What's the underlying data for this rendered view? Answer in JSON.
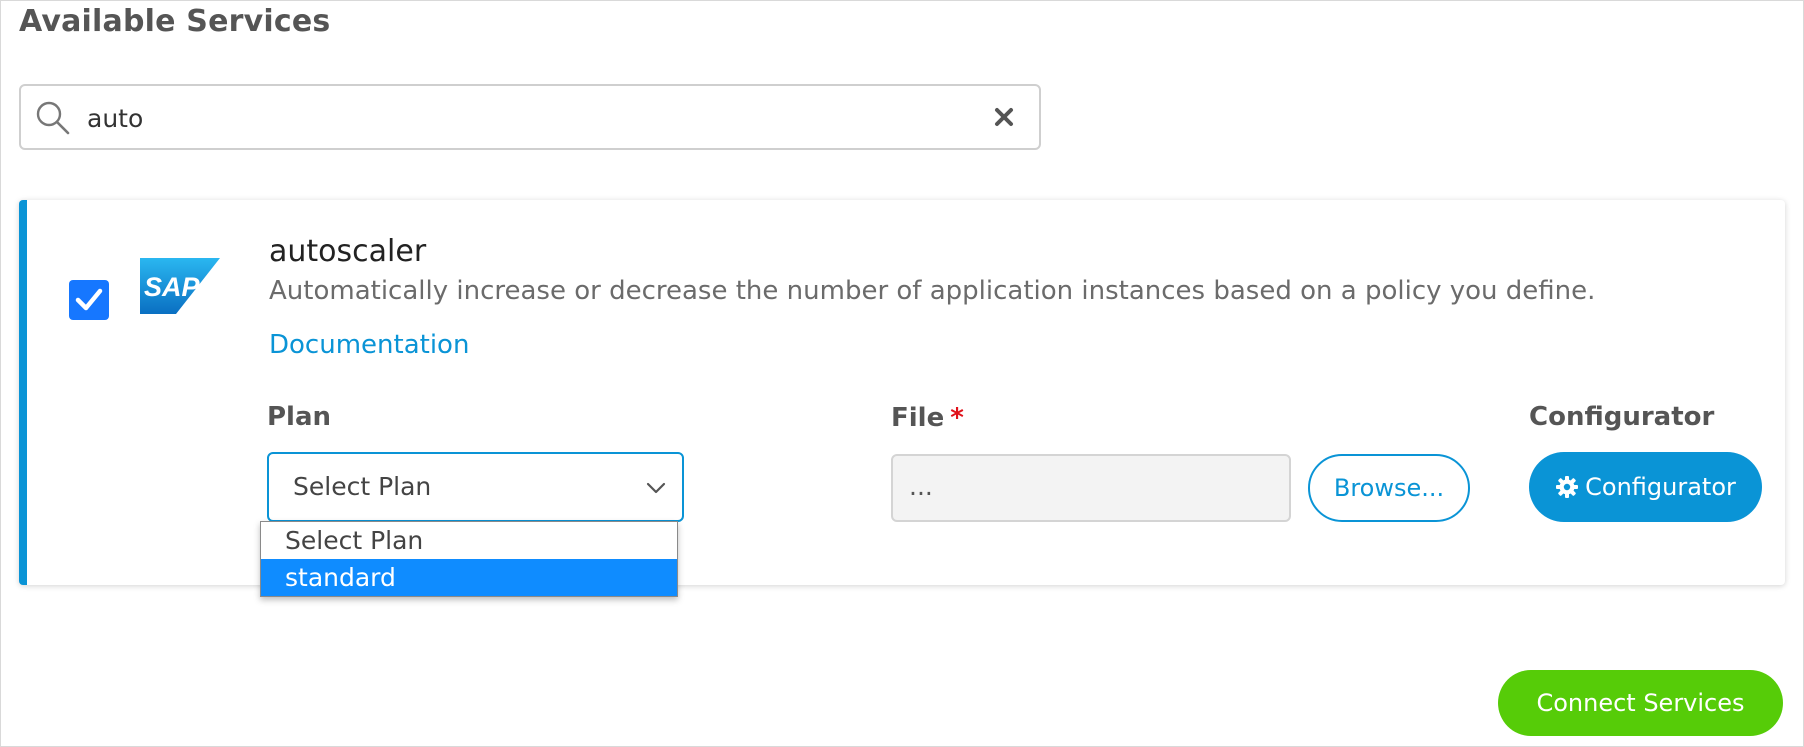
{
  "page": {
    "title": "Available Services"
  },
  "search": {
    "value": "auto",
    "icon": "search-icon",
    "clear_icon": "close-icon"
  },
  "service": {
    "checked": true,
    "logo": "SAP",
    "name": "autoscaler",
    "description": "Automatically increase or decrease the number of application instances based on a policy you define.",
    "doc_link": "Documentation",
    "plan": {
      "label": "Plan",
      "selected": "Select Plan",
      "options": [
        "Select Plan",
        "standard"
      ],
      "highlighted": "standard"
    },
    "file": {
      "label": "File",
      "required_mark": "*",
      "value": "...",
      "browse_label": "Browse..."
    },
    "configurator": {
      "label": "Configurator",
      "button_label": "Configurator",
      "icon": "gear-icon"
    }
  },
  "actions": {
    "connect_label": "Connect Services"
  },
  "colors": {
    "accent_blue": "#0a94d6",
    "option_highlight": "#0f8cff",
    "checkbox_blue": "#1677ff",
    "connect_green": "#56cc08",
    "required_red": "#e0121b"
  }
}
